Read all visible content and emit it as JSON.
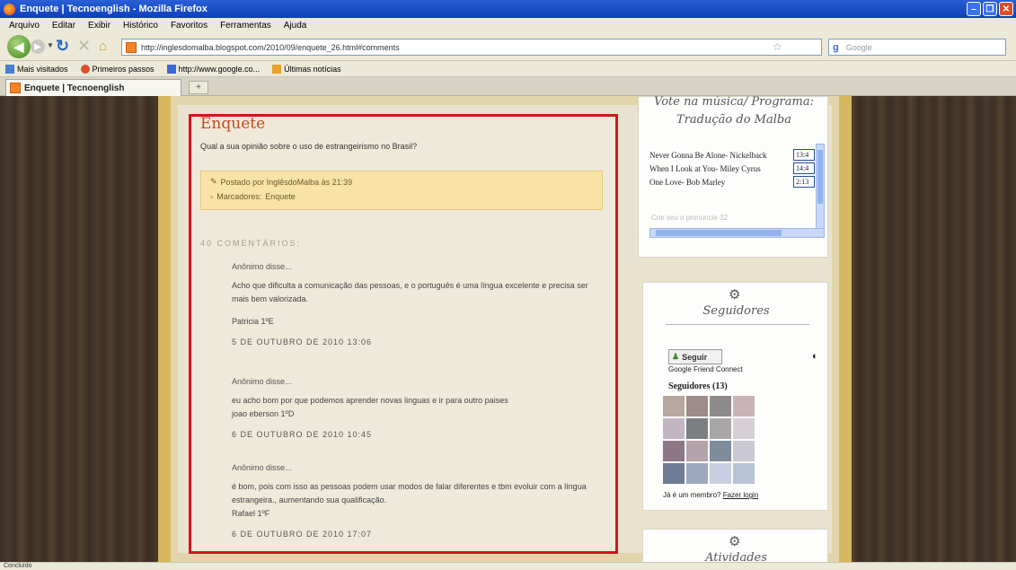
{
  "window": {
    "title": "Enquete | Tecnoenglish - Mozilla Firefox"
  },
  "menu": [
    "Arquivo",
    "Editar",
    "Exibir",
    "Histórico",
    "Favoritos",
    "Ferramentas",
    "Ajuda"
  ],
  "navigation": {
    "url": "http://inglesdomalba.blogspot.com/2010/09/enquete_26.html#comments",
    "search_placeholder": "Google",
    "search_engine": "g"
  },
  "bookmarks": [
    {
      "label": "Mais visitados",
      "icon": "chart-icon",
      "color": "#4a7fd0"
    },
    {
      "label": "Primeiros passos",
      "icon": "firefox-icon",
      "color": "#d9502b"
    },
    {
      "label": "http://www.google.co...",
      "icon": "google-icon",
      "color": "#3b67d8"
    },
    {
      "label": "Últimas notícias",
      "icon": "rss-icon",
      "color": "#e8a12b"
    }
  ],
  "tab": {
    "label": "Enquete | Tecnoenglish",
    "new_tab": "+"
  },
  "post": {
    "title": "Enquete",
    "question": "Qual a sua opinião sobre o uso de estrangeirismo no Brasil?",
    "posted_by": "Postado por InglêsdoMalba às 21:39",
    "labels_prefix": "Marcadores:",
    "label": "Enquete",
    "comments_heading": "40 COMENTÁRIOS:"
  },
  "comments": [
    {
      "author": "Anônimo disse...",
      "body": "Acho que dificulta a comunicação das pessoas, e o português é uma língua excelente e precisa ser mais bem valorizada.",
      "signature": "Patricia 1ºE",
      "date": "5 DE OUTUBRO DE 2010 13:06"
    },
    {
      "author": "Anônimo disse...",
      "body": "eu acho bom por que podemos aprender novas linguas e ir para outro paises",
      "signature": "joao eberson 1ºD",
      "date": "6 DE OUTUBRO DE 2010 10:45"
    },
    {
      "author": "Anônimo disse...",
      "body": "é bom, pois com isso as pessoas podem usar modos de falar diferentes e tbm evoluir com a língua estrangeira., aumentando sua qualificação.",
      "signature": "Rafael 1ºF",
      "date": "6 DE OUTUBRO DE 2010 17:07"
    }
  ],
  "sidebar": {
    "music": {
      "heading_top": "Vote na música/ Programa:",
      "heading": "Tradução do Malba",
      "items": [
        {
          "title": "Never Gonna Be Alone- Nickelback",
          "time": "13:4"
        },
        {
          "title": "When I Look at You- Miley Cyrus",
          "time": "14:4"
        },
        {
          "title": "One Love- Bob Marley",
          "time": "2:13"
        }
      ],
      "meta": "Crie seu o pronuncie 32"
    },
    "followers": {
      "heading": "Seguidores",
      "follow_button": "Seguir",
      "gfc": "Google Friend Connect",
      "count_label": "Seguidores (13)",
      "member_prompt": "Já é um membro?",
      "login_link": "Fazer login",
      "avatar_colors": [
        "#b9a7a2",
        "#9c8b88",
        "#8f8a8c",
        "#c9b3b7",
        "#c4b5c3",
        "#7b7f82",
        "#a9a6a7",
        "#d7cfd6",
        "#8d7786",
        "#b5a3ac",
        "#7e8c9c",
        "#cac8d2",
        "#6f7c96",
        "#9ea9c1",
        "#c8cfe0",
        "#b9c3d8"
      ]
    },
    "activities": {
      "heading": "Atividades"
    }
  },
  "status": {
    "text": "Concluído"
  },
  "colors": {
    "highlight_border": "#d3141d",
    "title": "#c34b1d"
  }
}
